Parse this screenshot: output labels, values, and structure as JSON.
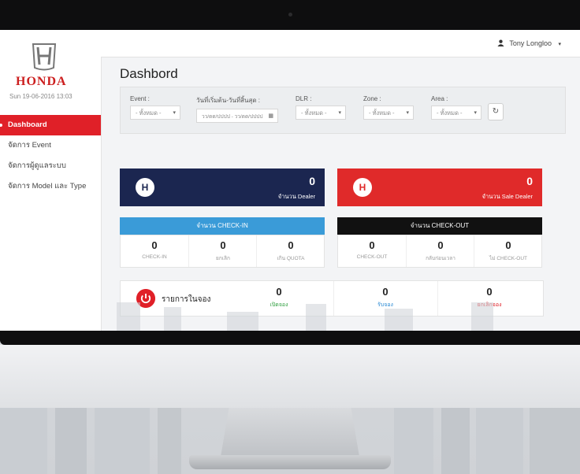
{
  "brand": {
    "name": "HONDA",
    "date": "Sun 19-06-2016 13:03",
    "accent": "#e02028"
  },
  "sidebar": {
    "items": [
      {
        "label": "Dashboard",
        "active": true
      },
      {
        "label": "จัดการ Event",
        "active": false
      },
      {
        "label": "จัดการผู้ดูแลระบบ",
        "active": false
      },
      {
        "label": "จัดการ Model และ Type",
        "active": false
      }
    ]
  },
  "topbar": {
    "user": "Tony Longloo",
    "user_icon": "user-icon",
    "caret": "▾"
  },
  "page": {
    "title": "Dashbord"
  },
  "filters": {
    "event": {
      "label": "Event :",
      "value": "- ทั้งหมด -"
    },
    "daterange": {
      "label": "วันที่เริ่มต้น-วันที่สิ้นสุด :",
      "value": "วว/ดด/ปปปป - วว/ดด/ปปปป"
    },
    "dlr": {
      "label": "DLR :",
      "value": "- ทั้งหมด -"
    },
    "zone": {
      "label": "Zone :",
      "value": "- ทั้งหมด -"
    },
    "area": {
      "label": "Area :",
      "value": "- ทั้งหมด -"
    },
    "refresh_icon": "refresh-icon"
  },
  "cards": {
    "dealer": {
      "badge": "H",
      "value": "0",
      "label": "จำนวน Dealer",
      "color": "#1b2650"
    },
    "sale": {
      "badge": "H",
      "value": "0",
      "label": "จำนวน Sale Dealer",
      "color": "#e02a2a"
    }
  },
  "checkin": {
    "title": "จำนวน CHECK-IN",
    "cells": [
      {
        "value": "0",
        "label": "CHECK-IN"
      },
      {
        "value": "0",
        "label": "ยกเลิก"
      },
      {
        "value": "0",
        "label": "เกิน QUOTA"
      }
    ]
  },
  "checkout": {
    "title": "จำนวน CHECK-OUT",
    "cells": [
      {
        "value": "0",
        "label": "CHECK-OUT"
      },
      {
        "value": "0",
        "label": "กลับก่อนเวลา"
      },
      {
        "value": "0",
        "label": "ไม่ CHECK-OUT"
      }
    ]
  },
  "queue": {
    "title": "รายการในจอง",
    "cells": [
      {
        "value": "0",
        "label": "เปิดจอง",
        "color": "#2e9e3e"
      },
      {
        "value": "0",
        "label": "รับจอง",
        "color": "#2a8ad4"
      },
      {
        "value": "0",
        "label": "ยกเลิกจอง",
        "color": "#e02028"
      }
    ]
  }
}
